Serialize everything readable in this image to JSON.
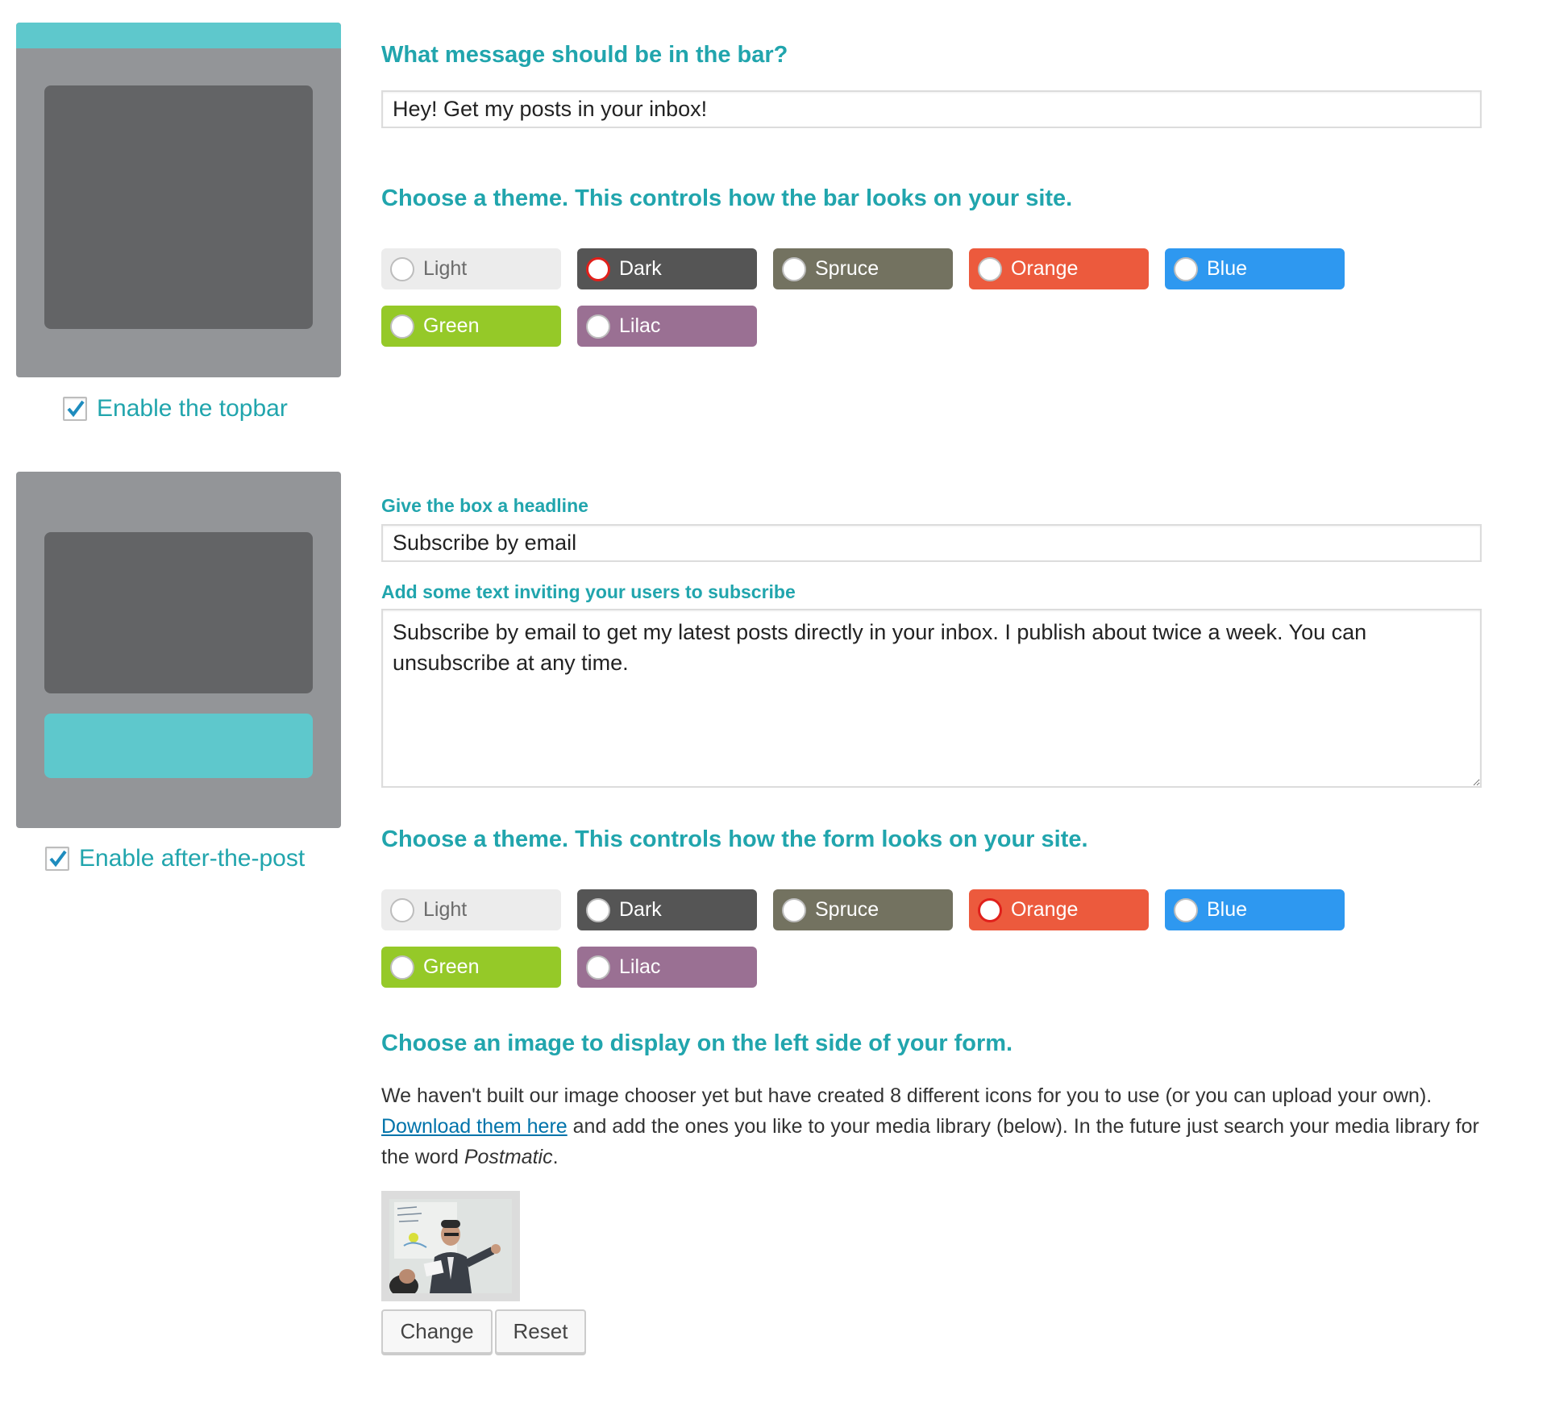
{
  "topbar": {
    "enable_label": "Enable the topbar",
    "enabled": true,
    "message_heading": "What message should be in the bar?",
    "message_value": "Hey! Get my posts in your inbox!",
    "theme_heading": "Choose a theme. This controls how the bar looks on your site.",
    "selected_theme": "Dark"
  },
  "after_post": {
    "enable_label": "Enable after-the-post",
    "enabled": true,
    "headline_label": "Give the box a headline",
    "headline_value": "Subscribe by email",
    "text_label": "Add some text inviting your users to subscribe",
    "text_value": "Subscribe by email to get my latest posts directly in your inbox. I publish about twice a week. You can unsubscribe at any time.",
    "theme_heading": "Choose a theme. This controls how the form looks on your site.",
    "selected_theme": "Orange"
  },
  "themes": [
    {
      "label": "Light",
      "color": "#ececec"
    },
    {
      "label": "Dark",
      "color": "#555555"
    },
    {
      "label": "Spruce",
      "color": "#737260"
    },
    {
      "label": "Orange",
      "color": "#ec5a3d"
    },
    {
      "label": "Blue",
      "color": "#2e98f0"
    },
    {
      "label": "Green",
      "color": "#95c928"
    },
    {
      "label": "Lilac",
      "color": "#9a7093"
    }
  ],
  "image_section": {
    "heading": "Choose an image to display on the left side of your form.",
    "desc_part1": "We haven't built our image chooser yet but have created 8 different icons for you to use (or you can upload your own). ",
    "desc_link": "Download them here",
    "desc_part2": " and add the ones you like to your media library (below). In the future just search your media library for the word ",
    "desc_em": "Postmatic",
    "desc_end": ".",
    "change_label": "Change",
    "reset_label": "Reset"
  },
  "colors": {
    "accent": "#21a5ad",
    "preview_teal": "#5ec8cc",
    "preview_gray": "#939598",
    "preview_dark": "#636466",
    "selected_radio": "#e0201b"
  }
}
